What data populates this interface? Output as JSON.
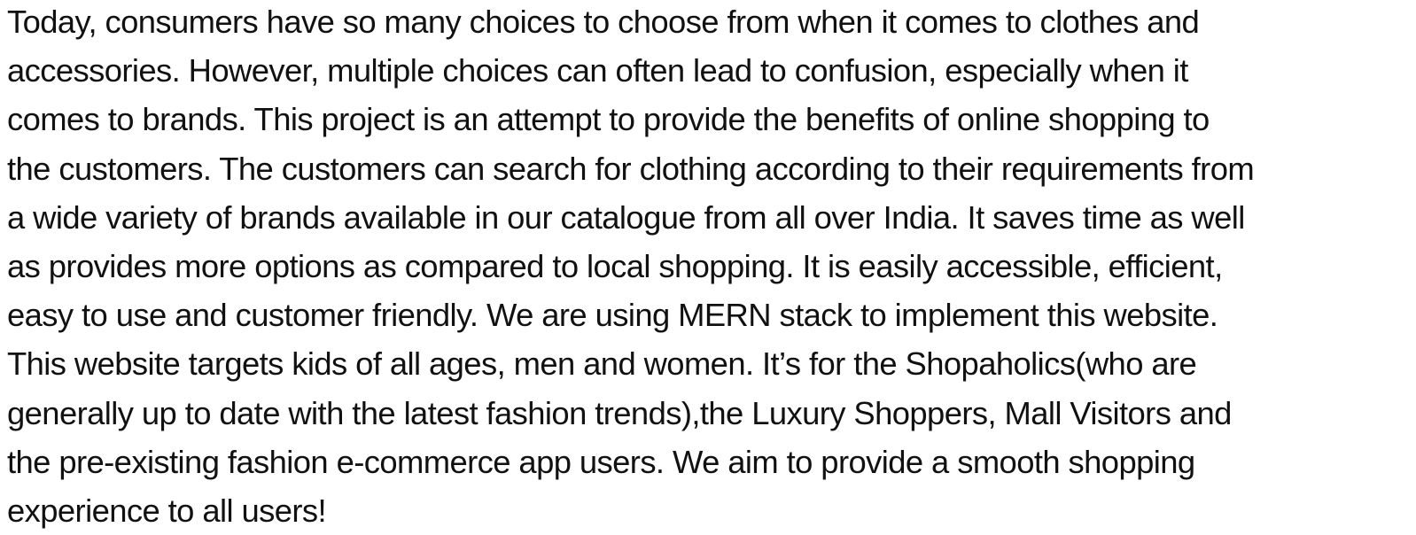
{
  "document": {
    "lines": [
      "Today, consumers have so many choices to choose from when it comes to clothes and",
      "accessories. However, multiple choices can often lead to confusion, especially when it",
      "comes to brands. This project is an attempt to provide the benefits of online shopping to",
      "the customers. The customers can search for clothing according to their requirements from",
      "a wide variety of brands available in our catalogue from all over India. It saves time as well",
      "as provides more options as compared to local shopping. It is easily accessible, efficient,",
      "easy to use and customer friendly. We are using MERN stack to implement this website.",
      "This website targets kids of all ages, men and women. It’s for the Shopaholics(who are",
      "generally up to date with the latest fashion trends),the Luxury Shoppers, Mall Visitors and",
      "the pre-existing fashion e-commerce app users. We aim to provide a smooth shopping",
      "experience to all users!"
    ]
  }
}
